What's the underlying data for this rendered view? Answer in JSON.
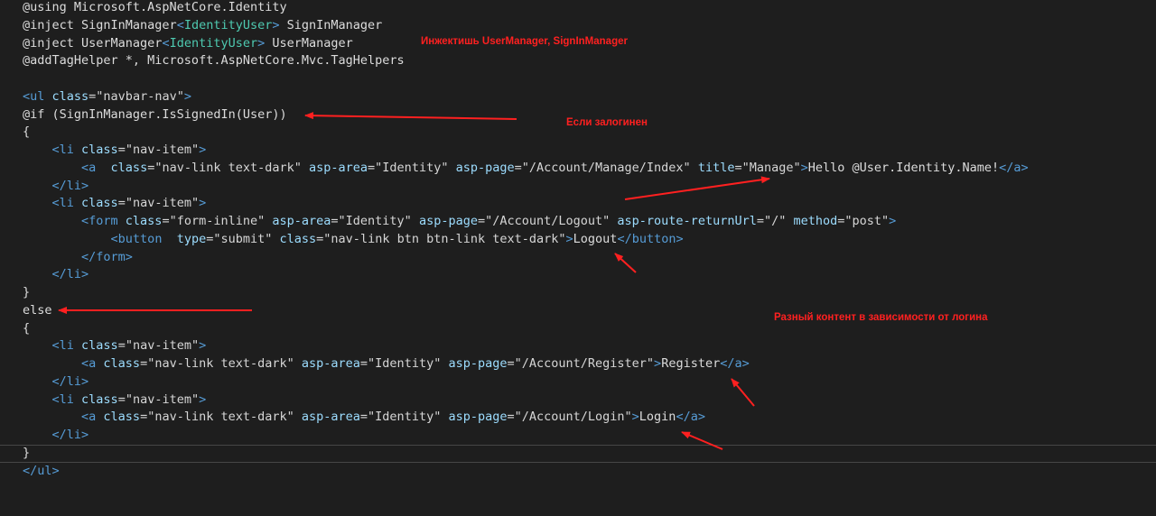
{
  "editor": {
    "lines": [
      {
        "segments": [
          {
            "t": "@using Microsoft.AspNetCore.Identity",
            "c": "dir"
          }
        ]
      },
      {
        "segments": [
          {
            "t": "@inject SignInManager",
            "c": "dir"
          },
          {
            "t": "<",
            "c": "tag"
          },
          {
            "t": "IdentityUser",
            "c": "type"
          },
          {
            "t": ">",
            "c": "tag"
          },
          {
            "t": " SignInManager",
            "c": "text"
          }
        ]
      },
      {
        "segments": [
          {
            "t": "@inject UserManager",
            "c": "dir"
          },
          {
            "t": "<",
            "c": "tag"
          },
          {
            "t": "IdentityUser",
            "c": "type"
          },
          {
            "t": ">",
            "c": "tag"
          },
          {
            "t": " UserManager",
            "c": "text"
          }
        ]
      },
      {
        "segments": [
          {
            "t": "@addTagHelper *, Microsoft.AspNetCore.Mvc.TagHelpers",
            "c": "dir"
          }
        ]
      },
      {
        "segments": []
      },
      {
        "segments": [
          {
            "t": "<ul",
            "c": "tag"
          },
          {
            "t": " class",
            "c": "attr"
          },
          {
            "t": "=\"navbar-nav\"",
            "c": "str"
          },
          {
            "t": ">",
            "c": "tag"
          }
        ]
      },
      {
        "segments": [
          {
            "t": "@if (SignInManager.IsSignedIn(User))",
            "c": "text"
          }
        ]
      },
      {
        "segments": [
          {
            "t": "{",
            "c": "text"
          }
        ]
      },
      {
        "segments": [
          {
            "t": "    ",
            "c": "text"
          },
          {
            "t": "<li",
            "c": "tag"
          },
          {
            "t": " class",
            "c": "attr"
          },
          {
            "t": "=\"nav-item\"",
            "c": "str"
          },
          {
            "t": ">",
            "c": "tag"
          }
        ]
      },
      {
        "segments": [
          {
            "t": "        ",
            "c": "text"
          },
          {
            "t": "<a",
            "c": "tag"
          },
          {
            "t": "  class",
            "c": "attr"
          },
          {
            "t": "=\"nav-link text-dark\"",
            "c": "str"
          },
          {
            "t": " asp-area",
            "c": "attr"
          },
          {
            "t": "=\"Identity\"",
            "c": "str"
          },
          {
            "t": " asp-page",
            "c": "attr"
          },
          {
            "t": "=\"/Account/Manage/Index\"",
            "c": "str"
          },
          {
            "t": " title",
            "c": "attr"
          },
          {
            "t": "=\"Manage\"",
            "c": "str"
          },
          {
            "t": ">",
            "c": "tag"
          },
          {
            "t": "Hello @User.Identity.Name!",
            "c": "text"
          },
          {
            "t": "</a>",
            "c": "tag"
          }
        ]
      },
      {
        "segments": [
          {
            "t": "    ",
            "c": "text"
          },
          {
            "t": "</li>",
            "c": "tag"
          }
        ]
      },
      {
        "segments": [
          {
            "t": "    ",
            "c": "text"
          },
          {
            "t": "<li",
            "c": "tag"
          },
          {
            "t": " class",
            "c": "attr"
          },
          {
            "t": "=\"nav-item\"",
            "c": "str"
          },
          {
            "t": ">",
            "c": "tag"
          }
        ]
      },
      {
        "segments": [
          {
            "t": "        ",
            "c": "text"
          },
          {
            "t": "<form",
            "c": "tag"
          },
          {
            "t": " class",
            "c": "attr"
          },
          {
            "t": "=\"form-inline\"",
            "c": "str"
          },
          {
            "t": " asp-area",
            "c": "attr"
          },
          {
            "t": "=\"Identity\"",
            "c": "str"
          },
          {
            "t": " asp-page",
            "c": "attr"
          },
          {
            "t": "=\"/Account/Logout\"",
            "c": "str"
          },
          {
            "t": " asp-route-returnUrl",
            "c": "attr"
          },
          {
            "t": "=\"/\"",
            "c": "str"
          },
          {
            "t": " method",
            "c": "attr"
          },
          {
            "t": "=\"post\"",
            "c": "str"
          },
          {
            "t": ">",
            "c": "tag"
          }
        ]
      },
      {
        "segments": [
          {
            "t": "            ",
            "c": "text"
          },
          {
            "t": "<button",
            "c": "tag"
          },
          {
            "t": "  type",
            "c": "attr"
          },
          {
            "t": "=\"submit\"",
            "c": "str"
          },
          {
            "t": " class",
            "c": "attr"
          },
          {
            "t": "=\"nav-link btn btn-link text-dark\"",
            "c": "str"
          },
          {
            "t": ">",
            "c": "tag"
          },
          {
            "t": "Logout",
            "c": "text"
          },
          {
            "t": "</button>",
            "c": "tag"
          }
        ]
      },
      {
        "segments": [
          {
            "t": "        ",
            "c": "text"
          },
          {
            "t": "</form>",
            "c": "tag"
          }
        ]
      },
      {
        "segments": [
          {
            "t": "    ",
            "c": "text"
          },
          {
            "t": "</li>",
            "c": "tag"
          }
        ]
      },
      {
        "segments": [
          {
            "t": "}",
            "c": "text"
          }
        ]
      },
      {
        "segments": [
          {
            "t": "else",
            "c": "text"
          }
        ]
      },
      {
        "segments": [
          {
            "t": "{",
            "c": "text"
          }
        ]
      },
      {
        "segments": [
          {
            "t": "    ",
            "c": "text"
          },
          {
            "t": "<li",
            "c": "tag"
          },
          {
            "t": " class",
            "c": "attr"
          },
          {
            "t": "=\"nav-item\"",
            "c": "str"
          },
          {
            "t": ">",
            "c": "tag"
          }
        ]
      },
      {
        "segments": [
          {
            "t": "        ",
            "c": "text"
          },
          {
            "t": "<a",
            "c": "tag"
          },
          {
            "t": " class",
            "c": "attr"
          },
          {
            "t": "=\"nav-link text-dark\"",
            "c": "str"
          },
          {
            "t": " asp-area",
            "c": "attr"
          },
          {
            "t": "=\"Identity\"",
            "c": "str"
          },
          {
            "t": " asp-page",
            "c": "attr"
          },
          {
            "t": "=\"/Account/Register\"",
            "c": "str"
          },
          {
            "t": ">",
            "c": "tag"
          },
          {
            "t": "Register",
            "c": "text"
          },
          {
            "t": "</a>",
            "c": "tag"
          }
        ]
      },
      {
        "segments": [
          {
            "t": "    ",
            "c": "text"
          },
          {
            "t": "</li>",
            "c": "tag"
          }
        ]
      },
      {
        "segments": [
          {
            "t": "    ",
            "c": "text"
          },
          {
            "t": "<li",
            "c": "tag"
          },
          {
            "t": " class",
            "c": "attr"
          },
          {
            "t": "=\"nav-item\"",
            "c": "str"
          },
          {
            "t": ">",
            "c": "tag"
          }
        ]
      },
      {
        "segments": [
          {
            "t": "        ",
            "c": "text"
          },
          {
            "t": "<a",
            "c": "tag"
          },
          {
            "t": " class",
            "c": "attr"
          },
          {
            "t": "=\"nav-link text-dark\"",
            "c": "str"
          },
          {
            "t": " asp-area",
            "c": "attr"
          },
          {
            "t": "=\"Identity\"",
            "c": "str"
          },
          {
            "t": " asp-page",
            "c": "attr"
          },
          {
            "t": "=\"/Account/Login\"",
            "c": "str"
          },
          {
            "t": ">",
            "c": "tag"
          },
          {
            "t": "Login",
            "c": "text"
          },
          {
            "t": "</a>",
            "c": "tag"
          }
        ]
      },
      {
        "segments": [
          {
            "t": "    ",
            "c": "text"
          },
          {
            "t": "</li>",
            "c": "tag"
          }
        ]
      },
      {
        "segments": [
          {
            "t": "}",
            "c": "text"
          }
        ]
      },
      {
        "segments": [
          {
            "t": "</ul>",
            "c": "tag"
          }
        ]
      }
    ]
  },
  "annotations": {
    "inject_note": "Инжектишь UserManager, SignInManager",
    "signed_in_note": "Если залогинен",
    "content_note": "Разный контент в зависимости от логина"
  },
  "colors": {
    "background": "#1e1e1e",
    "text": "#dcdcdc",
    "tag": "#569cd6",
    "attribute": "#9cdcfe",
    "string": "#d6d6d6",
    "type": "#4ec9b0",
    "annotation": "#ff2020"
  }
}
